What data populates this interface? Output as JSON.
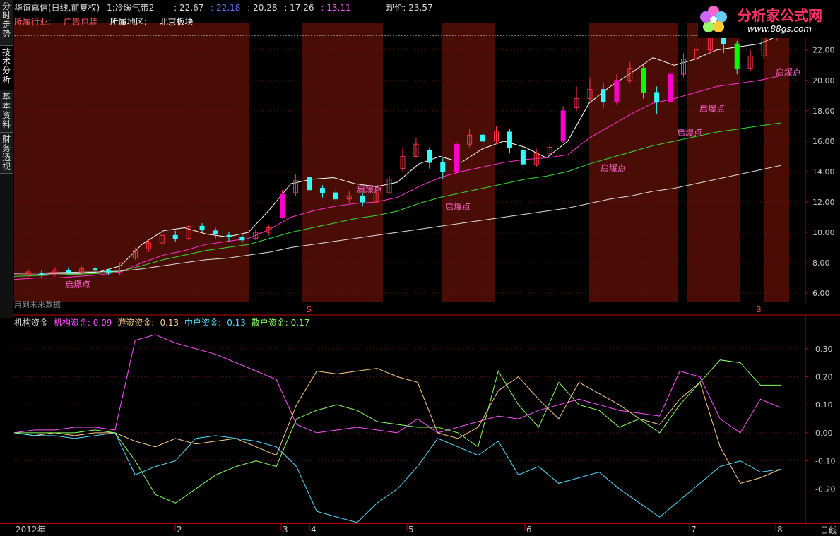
{
  "title": {
    "stock": "华谊嘉信(日线,前复权)",
    "indicator": "1:冷暖气带2",
    "v1": ": 22.67",
    "v2": ": 22.18",
    "v3": ": 20.28",
    "v4": ": 17.26",
    "v5": ": 13.11",
    "price_label": "现价: 23.57"
  },
  "info": {
    "industry_label": "所属行业:",
    "industry": "广告包装",
    "region_label": "所属地区:",
    "region": "北京板块"
  },
  "side_tabs": [
    {
      "label": "分时走势"
    },
    {
      "label": "技术分析"
    },
    {
      "label": "基本资料"
    },
    {
      "label": "财务透视"
    }
  ],
  "logo": {
    "name": "分析家公式网",
    "url": "www.88gs.com"
  },
  "signal_label": "启爆点",
  "note": "用到未来数据",
  "markers": {
    "s": "S",
    "b": "B"
  },
  "indicator": {
    "name": "机构资金",
    "items": [
      {
        "label": "机构资金: 0.09",
        "color": "#ff55ff"
      },
      {
        "label": "游资资金: -0.13",
        "color": "#ffcc88"
      },
      {
        "label": "中户资金: -0.13",
        "color": "#55ddff"
      },
      {
        "label": "散户资金: 0.17",
        "color": "#88ff66"
      }
    ]
  },
  "bottom": {
    "year": "2012年",
    "months": [
      "2",
      "3",
      "4",
      "5",
      "6",
      "7",
      "8"
    ],
    "period": "日线"
  },
  "chart_data": {
    "type": "line",
    "price_axis": [
      6.0,
      8.0,
      10.0,
      12.0,
      14.0,
      16.0,
      18.0,
      20.0,
      22.0
    ],
    "indicator_axis": [
      0.3,
      0.2,
      0.1,
      0.0,
      -0.1,
      -0.2
    ],
    "ma_series": [
      {
        "color": "#ffffff",
        "values": [
          7.2,
          7.2,
          7.3,
          7.3,
          7.4,
          7.8,
          9.2,
          10.1,
          10.3,
          9.9,
          9.7,
          10.0,
          11.5,
          13.2,
          13.5,
          13.6,
          13.2,
          13.0,
          13.3,
          14.5,
          15.0,
          14.6,
          15.5,
          16.0,
          15.6,
          14.9,
          16.0,
          18.5,
          19.6,
          20.5,
          21.5,
          21.0,
          21.4,
          22.0,
          22.2,
          22.4,
          23.0
        ]
      },
      {
        "color": "#ff33cc",
        "values": [
          6.9,
          7.0,
          7.0,
          7.1,
          7.2,
          7.4,
          8.0,
          8.5,
          8.8,
          9.2,
          9.4,
          9.6,
          10.2,
          11.0,
          11.4,
          11.7,
          11.9,
          12.0,
          12.3,
          13.0,
          13.6,
          14.0,
          14.3,
          14.6,
          14.8,
          14.9,
          15.1,
          16.2,
          17.0,
          17.8,
          18.5,
          18.8,
          19.2,
          19.6,
          19.8,
          20.0,
          20.3
        ]
      },
      {
        "color": "#33dd33",
        "values": [
          7.1,
          7.15,
          7.2,
          7.25,
          7.3,
          7.45,
          7.8,
          8.2,
          8.5,
          8.8,
          9.0,
          9.2,
          9.6,
          10.0,
          10.3,
          10.6,
          10.9,
          11.1,
          11.4,
          11.9,
          12.3,
          12.6,
          12.9,
          13.2,
          13.5,
          13.7,
          14.0,
          14.5,
          14.9,
          15.3,
          15.7,
          16.0,
          16.3,
          16.6,
          16.8,
          17.0,
          17.2
        ]
      },
      {
        "color": "#dddddd",
        "values": [
          7.3,
          7.32,
          7.35,
          7.38,
          7.4,
          7.45,
          7.6,
          7.8,
          8.0,
          8.2,
          8.3,
          8.5,
          8.7,
          9.0,
          9.2,
          9.4,
          9.6,
          9.8,
          10.0,
          10.2,
          10.4,
          10.6,
          10.8,
          11.0,
          11.2,
          11.4,
          11.6,
          11.9,
          12.2,
          12.4,
          12.7,
          12.9,
          13.2,
          13.5,
          13.8,
          14.1,
          14.4
        ]
      }
    ],
    "candles": [
      {
        "o": 7.2,
        "c": 7.4,
        "h": 7.6,
        "l": 7.0
      },
      {
        "o": 7.3,
        "c": 7.2,
        "h": 7.5,
        "l": 7.0
      },
      {
        "o": 7.2,
        "c": 7.5,
        "h": 7.7,
        "l": 7.1
      },
      {
        "o": 7.5,
        "c": 7.4,
        "h": 7.7,
        "l": 7.2
      },
      {
        "o": 7.4,
        "c": 7.6,
        "h": 7.8,
        "l": 7.3
      },
      {
        "o": 7.6,
        "c": 7.5,
        "h": 7.8,
        "l": 7.3
      },
      {
        "o": 7.5,
        "c": 7.4,
        "h": 7.6,
        "l": 7.2
      },
      {
        "o": 7.2,
        "c": 8.0,
        "h": 8.1,
        "l": 7.1
      },
      {
        "o": 8.3,
        "c": 8.8,
        "h": 9.0,
        "l": 8.2
      },
      {
        "o": 8.9,
        "c": 9.3,
        "h": 9.5,
        "l": 8.7
      },
      {
        "o": 9.3,
        "c": 9.8,
        "h": 10.0,
        "l": 9.2
      },
      {
        "o": 9.8,
        "c": 9.6,
        "h": 10.1,
        "l": 9.4
      },
      {
        "o": 9.6,
        "c": 10.4,
        "h": 10.5,
        "l": 9.5
      },
      {
        "o": 10.4,
        "c": 10.2,
        "h": 10.6,
        "l": 10.0
      },
      {
        "o": 10.1,
        "c": 9.9,
        "h": 10.3,
        "l": 9.6
      },
      {
        "o": 9.8,
        "c": 9.7,
        "h": 10.0,
        "l": 9.4
      },
      {
        "o": 9.7,
        "c": 9.5,
        "h": 9.9,
        "l": 9.3
      },
      {
        "o": 9.6,
        "c": 10.0,
        "h": 10.2,
        "l": 9.5
      },
      {
        "o": 10.0,
        "c": 10.3,
        "h": 10.5,
        "l": 9.8
      },
      {
        "o": 11.0,
        "c": 12.5,
        "h": 12.8,
        "l": 10.9
      },
      {
        "o": 12.6,
        "c": 13.4,
        "h": 13.8,
        "l": 12.4
      },
      {
        "o": 13.6,
        "c": 12.8,
        "h": 13.9,
        "l": 12.6
      },
      {
        "o": 12.9,
        "c": 12.6,
        "h": 13.1,
        "l": 12.3
      },
      {
        "o": 12.6,
        "c": 12.2,
        "h": 12.9,
        "l": 12.0
      },
      {
        "o": 12.2,
        "c": 12.4,
        "h": 12.7,
        "l": 11.9
      },
      {
        "o": 12.4,
        "c": 12.0,
        "h": 12.6,
        "l": 11.7
      },
      {
        "o": 12.0,
        "c": 12.6,
        "h": 12.8,
        "l": 11.9
      },
      {
        "o": 12.6,
        "c": 13.5,
        "h": 13.7,
        "l": 12.5
      },
      {
        "o": 14.2,
        "c": 15.0,
        "h": 15.6,
        "l": 14.0
      },
      {
        "o": 15.0,
        "c": 15.8,
        "h": 16.2,
        "l": 14.9
      },
      {
        "o": 15.4,
        "c": 14.6,
        "h": 15.6,
        "l": 14.2
      },
      {
        "o": 14.6,
        "c": 14.0,
        "h": 14.9,
        "l": 13.5
      },
      {
        "o": 14.0,
        "c": 15.8,
        "h": 16.0,
        "l": 13.8
      },
      {
        "o": 15.8,
        "c": 16.4,
        "h": 16.8,
        "l": 15.6
      },
      {
        "o": 16.4,
        "c": 16.0,
        "h": 16.9,
        "l": 15.6
      },
      {
        "o": 16.0,
        "c": 16.6,
        "h": 17.0,
        "l": 15.8
      },
      {
        "o": 16.6,
        "c": 15.6,
        "h": 16.8,
        "l": 15.2
      },
      {
        "o": 15.4,
        "c": 14.5,
        "h": 15.6,
        "l": 14.2
      },
      {
        "o": 14.5,
        "c": 15.2,
        "h": 15.5,
        "l": 14.3
      },
      {
        "o": 15.2,
        "c": 15.6,
        "h": 15.9,
        "l": 15.0
      },
      {
        "o": 16.0,
        "c": 18.0,
        "h": 18.3,
        "l": 15.9
      },
      {
        "o": 18.2,
        "c": 18.8,
        "h": 19.6,
        "l": 18.0
      },
      {
        "o": 18.8,
        "c": 19.4,
        "h": 20.2,
        "l": 18.6
      },
      {
        "o": 19.4,
        "c": 18.6,
        "h": 19.8,
        "l": 18.2
      },
      {
        "o": 18.6,
        "c": 20.0,
        "h": 20.4,
        "l": 18.4
      },
      {
        "o": 20.0,
        "c": 20.8,
        "h": 21.2,
        "l": 19.8
      },
      {
        "o": 20.8,
        "c": 19.2,
        "h": 21.0,
        "l": 18.8
      },
      {
        "o": 19.2,
        "c": 18.6,
        "h": 19.6,
        "l": 17.8
      },
      {
        "o": 18.6,
        "c": 20.4,
        "h": 20.8,
        "l": 18.4
      },
      {
        "o": 20.4,
        "c": 21.4,
        "h": 21.8,
        "l": 20.2
      },
      {
        "o": 21.4,
        "c": 22.0,
        "h": 22.6,
        "l": 21.0
      },
      {
        "o": 22.0,
        "c": 23.0,
        "h": 23.6,
        "l": 21.8
      },
      {
        "o": 23.0,
        "c": 22.4,
        "h": 23.4,
        "l": 21.8
      },
      {
        "o": 22.4,
        "c": 20.8,
        "h": 22.6,
        "l": 20.4
      },
      {
        "o": 20.8,
        "c": 21.6,
        "h": 22.0,
        "l": 20.6
      },
      {
        "o": 21.6,
        "c": 22.8,
        "h": 23.2,
        "l": 21.4
      },
      {
        "o": 22.8,
        "c": 23.6,
        "h": 24.0,
        "l": 22.6
      }
    ],
    "indicator_series": [
      {
        "name": "机构资金",
        "color": "#ff55ff",
        "values": [
          0.0,
          0.01,
          0.01,
          0.02,
          0.02,
          0.01,
          0.33,
          0.35,
          0.32,
          0.3,
          0.28,
          0.25,
          0.22,
          0.19,
          0.03,
          0.0,
          0.01,
          0.02,
          0.01,
          0.0,
          0.05,
          0.0,
          0.02,
          0.04,
          0.06,
          0.05,
          0.08,
          0.1,
          0.12,
          0.1,
          0.08,
          0.07,
          0.06,
          0.22,
          0.2,
          0.05,
          0.0,
          0.12,
          0.09
        ]
      },
      {
        "name": "游资资金",
        "color": "#ffcc88",
        "values": [
          0.0,
          -0.01,
          0.0,
          -0.01,
          0.0,
          0.0,
          -0.03,
          -0.05,
          -0.02,
          -0.04,
          -0.03,
          -0.02,
          -0.05,
          -0.08,
          0.1,
          0.22,
          0.21,
          0.22,
          0.23,
          0.2,
          0.18,
          0.0,
          -0.02,
          0.02,
          0.15,
          0.2,
          0.12,
          0.05,
          0.18,
          0.14,
          0.1,
          0.05,
          0.03,
          0.12,
          0.18,
          -0.05,
          -0.18,
          -0.16,
          -0.13
        ]
      },
      {
        "name": "中户资金",
        "color": "#55ddff",
        "values": [
          0.0,
          -0.01,
          -0.01,
          -0.02,
          -0.01,
          0.0,
          -0.15,
          -0.12,
          -0.1,
          -0.02,
          -0.01,
          -0.02,
          -0.03,
          -0.05,
          -0.12,
          -0.28,
          -0.3,
          -0.32,
          -0.25,
          -0.2,
          -0.12,
          -0.02,
          -0.05,
          -0.08,
          -0.03,
          -0.15,
          -0.12,
          -0.18,
          -0.16,
          -0.14,
          -0.2,
          -0.25,
          -0.3,
          -0.24,
          -0.18,
          -0.12,
          -0.1,
          -0.14,
          -0.13
        ]
      },
      {
        "name": "散户资金",
        "color": "#88ff66",
        "values": [
          0.0,
          0.0,
          0.0,
          0.0,
          0.01,
          0.0,
          -0.1,
          -0.22,
          -0.25,
          -0.2,
          -0.15,
          -0.12,
          -0.1,
          -0.12,
          0.05,
          0.08,
          0.1,
          0.08,
          0.04,
          0.03,
          0.02,
          0.02,
          0.0,
          -0.05,
          0.22,
          0.1,
          0.02,
          0.18,
          0.1,
          0.08,
          0.02,
          0.05,
          0.0,
          0.1,
          0.18,
          0.26,
          0.25,
          0.17,
          0.17
        ]
      }
    ]
  }
}
